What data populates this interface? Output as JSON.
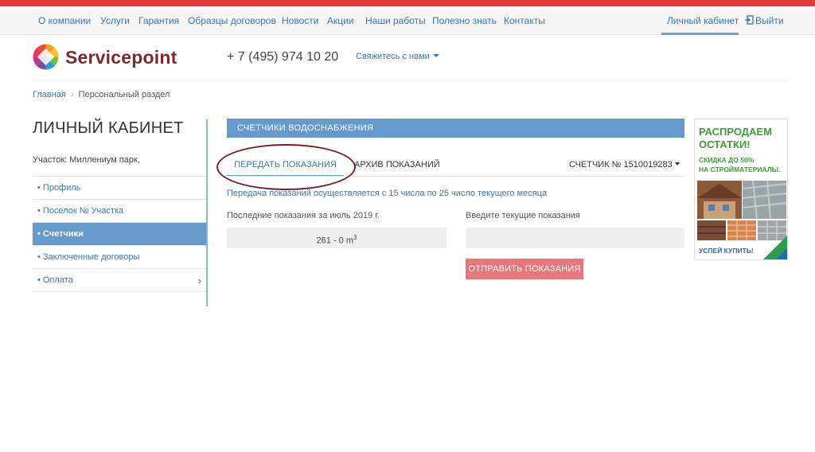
{
  "top_nav": {
    "items": [
      {
        "label": "О компании"
      },
      {
        "label": "Услуги"
      },
      {
        "label": "Гарантия"
      },
      {
        "label": "Образцы договоров"
      },
      {
        "label": "Новости"
      },
      {
        "label": "Акции"
      },
      {
        "label": "Наши работы"
      },
      {
        "label": "Полезно знать"
      },
      {
        "label": "Контакты"
      }
    ],
    "cabinet_label": "Личный кабинет",
    "logout_label": "Выйти"
  },
  "header": {
    "brand": "Servicepoint",
    "phone": "+ 7 (495) 974 10 20",
    "contact_label": "Свяжитесь с нами"
  },
  "breadcrumb": {
    "home": "Главная",
    "current": "Персональный раздел"
  },
  "sidebar": {
    "title": "ЛИЧНЫЙ КАБИНЕТ",
    "plot": "Участок: Миллениум парк,",
    "items": [
      {
        "label": "• Профиль"
      },
      {
        "label": "• Поселок № Участка"
      },
      {
        "label": "• Счетчики",
        "active": true
      },
      {
        "label": "• Заключенные договоры"
      },
      {
        "label": "• Оплата",
        "has_submenu": true
      }
    ]
  },
  "main": {
    "section_title": "СЧЕТЧИКИ ВОДОСНАБЖЕНИЯ",
    "tabs": [
      {
        "label": "ПЕРЕДАТЬ ПОКАЗАНИЯ",
        "active": true
      },
      {
        "label": "АРХИВ ПОКАЗАНИЙ"
      }
    ],
    "meter_label": "СЧЕТЧИК № 1510019283",
    "info": "Передача показаний осуществляется с 15 числа по 25 число текущего месяца",
    "last_readings_label": "Последние показания за июль 2019 г.",
    "last_readings_value": "261 - 0 m",
    "last_readings_unit_sup": "3",
    "enter_label": "Введите текущие показания",
    "input_value": "",
    "submit_label": "ОТПРАВИТЬ ПОКАЗАНИЯ"
  },
  "ad": {
    "headline_1": "РАСПРОДАЕМ",
    "headline_2": "ОСТАТКИ!",
    "sub_1": "СКИДКА ДО 50%",
    "sub_2": "НА СТРОЙМАТЕРИАЛЫ.",
    "cta": "УСПЕЙ КУПИТЬ!"
  },
  "colors": {
    "accent_red": "#dd3a3c",
    "link_blue": "#3c76b2",
    "panel_blue": "#6699cc",
    "button_pink": "#e8767a",
    "annotation_circle": "#7a1c2c",
    "ad_green": "#3f9a3a"
  }
}
